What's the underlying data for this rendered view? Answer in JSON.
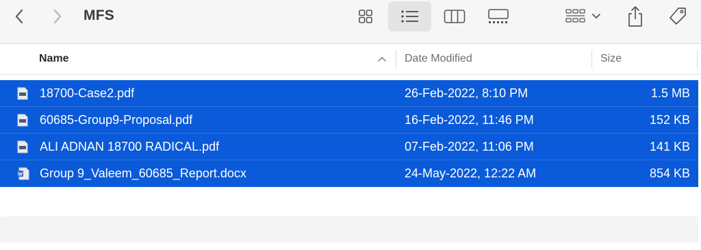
{
  "window": {
    "title": "MFS"
  },
  "toolbar": {
    "back_icon": "chevron-left-icon",
    "forward_icon": "chevron-right-icon",
    "views": [
      "icon-view-icon",
      "list-view-icon",
      "column-view-icon",
      "gallery-view-icon"
    ],
    "active_view": "list-view-icon",
    "group_icon": "group-grid-icon",
    "share_icon": "share-icon",
    "tag_icon": "tag-icon"
  },
  "header": {
    "name": "Name",
    "date_modified": "Date Modified",
    "size": "Size"
  },
  "files": [
    {
      "name": "18700-Case2.pdf",
      "date": "26-Feb-2022, 8:10 PM",
      "size": "1.5 MB",
      "icon": "pdf-file-icon"
    },
    {
      "name": "60685-Group9-Proposal.pdf",
      "date": "16-Feb-2022, 11:46 PM",
      "size": "152 KB",
      "icon": "pdf-file-icon"
    },
    {
      "name": "ALI ADNAN 18700 RADICAL.pdf",
      "date": "07-Feb-2022, 11:06 PM",
      "size": "141 KB",
      "icon": "pdf-file-icon"
    },
    {
      "name": "Group 9_Valeem_60685_Report.docx",
      "date": "24-May-2022, 12:22 AM",
      "size": "854 KB",
      "icon": "word-file-icon"
    }
  ],
  "colors": {
    "selection": "#0a5ad9",
    "toolbar_bg": "#f6f6f6"
  }
}
